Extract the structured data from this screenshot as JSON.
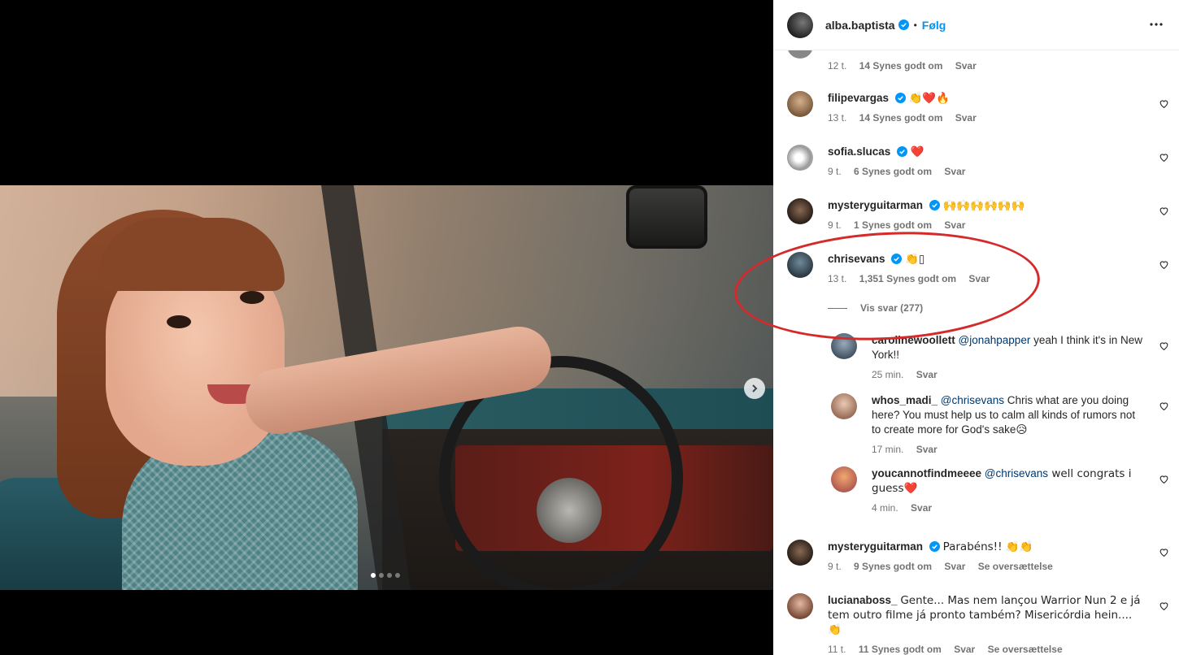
{
  "header": {
    "username": "alba.baptista",
    "separator": "•",
    "follow_label": "Følg"
  },
  "carousel": {
    "slide_count": 4,
    "active_index": 0
  },
  "comments": [
    {
      "time": "12 t.",
      "likes": "14 Synes godt om",
      "reply": "Svar"
    },
    {
      "username": "filipevargas",
      "text": "👏❤️🔥",
      "time": "13 t.",
      "likes": "14 Synes godt om",
      "reply": "Svar"
    },
    {
      "username": "sofia.slucas",
      "text": "❤️",
      "time": "9 t.",
      "likes": "6 Synes godt om",
      "reply": "Svar"
    },
    {
      "username": "mysteryguitarman",
      "text": "🙌🙌🙌🙌🙌🙌",
      "time": "9 t.",
      "likes": "1 Synes godt om",
      "reply": "Svar"
    },
    {
      "username": "chrisevans",
      "text": "👏",
      "text_extra": "▯",
      "time": "13 t.",
      "likes": "1,351 Synes godt om",
      "reply": "Svar",
      "view_replies": "Vis svar (277)"
    },
    {
      "username": "mysteryguitarman",
      "text": "Parabéns!! 👏👏",
      "time": "9 t.",
      "likes": "9 Synes godt om",
      "reply": "Svar",
      "translate": "Se oversættelse"
    },
    {
      "username": "lucianaboss_",
      "text": "Gente... Mas nem lançou Warrior Nun 2 e já tem outro filme já pronto também? Misericórdia hein.... 👏",
      "time": "11 t.",
      "likes": "11 Synes godt om",
      "reply": "Svar",
      "translate": "Se oversættelse"
    }
  ],
  "replies": [
    {
      "username": "carolinewoollett",
      "mention": "@jonahpapper",
      "text": " yeah I think it's in New York!!",
      "time": "25 min.",
      "reply": "Svar"
    },
    {
      "username": "whos_madi_",
      "mention": "@chrisevans",
      "text": " Chris what are you doing here? You must help us to calm all kinds of rumors not to create more for God's sake😥",
      "time": "17 min.",
      "reply": "Svar"
    },
    {
      "username": "youcannotfindmeeee",
      "mention": "@chrisevans",
      "text": " well congrats i guess❤️",
      "time": "4 min.",
      "reply": "Svar"
    }
  ],
  "colors": {
    "accent": "#0095f6",
    "verified": "#0095f6",
    "annotation": "#d42a2a"
  }
}
